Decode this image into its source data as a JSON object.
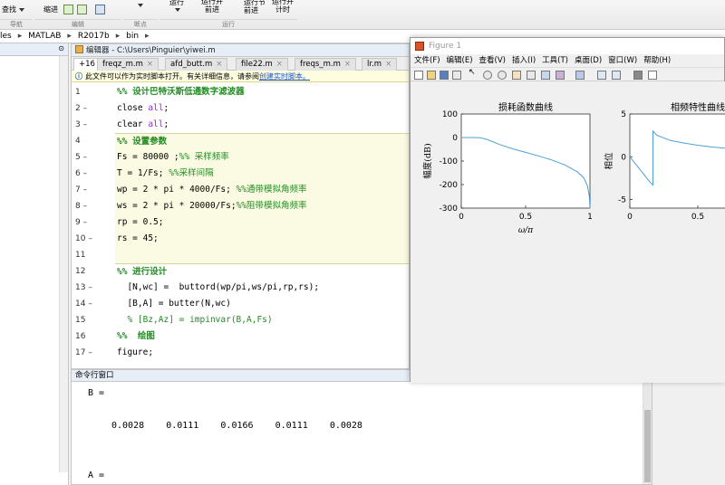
{
  "ribbon": {
    "btn_find": "查找",
    "btn_advance": "缩进",
    "sec_nav": "导航",
    "sec_edit": "编辑",
    "sec_break": "断点",
    "sec_run": "运行",
    "btn_run": "运行",
    "btn_runadv": "运行并\n前进",
    "btn_runsec": "运行节",
    "btn_advance2": "前进",
    "btn_runtime": "运行并\n计时"
  },
  "address": {
    "parts": [
      "les",
      "MATLAB",
      "R2017b",
      "bin"
    ]
  },
  "editor": {
    "title": "编辑器 - C:\\Users\\Pinguier\\yiwei.m",
    "tabs": [
      "+16",
      "freqz_m.m",
      "afd_butt.m",
      "file22.m",
      "freqs_m.m",
      "lr.m"
    ],
    "info": "此文件可以作为实时脚本打开。有关详细信息，请参阅",
    "info_link": "创建实时脚本。",
    "lines": [
      {
        "n": "1",
        "code": "%% 设计巴特沃斯低通数字滤波器"
      },
      {
        "n": "2 –",
        "code": "close all;"
      },
      {
        "n": "3 –",
        "code": "clear all;"
      },
      {
        "n": "4",
        "code": "%% 设置参数"
      },
      {
        "n": "5 –",
        "code": "Fs = 80000 ;%% 采样频率"
      },
      {
        "n": "6 –",
        "code": "T = 1/Fs; %%采样间隔"
      },
      {
        "n": "7 –",
        "code": "wp = 2 * pi * 4000/Fs; %%通带模拟角频率"
      },
      {
        "n": "8 –",
        "code": "ws = 2 * pi * 20000/Fs;%%阻带模拟角频率"
      },
      {
        "n": "9 –",
        "code": "rp = 0.5;"
      },
      {
        "n": "10 –",
        "code": "rs = 45;"
      },
      {
        "n": "11",
        "code": ""
      },
      {
        "n": "12",
        "code": "%% 进行设计"
      },
      {
        "n": "13 –",
        "code": "[N,wc] =  buttord(wp/pi,ws/pi,rp,rs);"
      },
      {
        "n": "14 –",
        "code": "[B,A] = butter(N,wc)"
      },
      {
        "n": "15",
        "code": "% [Bz,Az] = impinvar(B,A,Fs)"
      },
      {
        "n": "16",
        "code": "%%  绘图"
      },
      {
        "n": "17 –",
        "code": "figure;"
      }
    ]
  },
  "command": {
    "title": "命令行窗口",
    "line_b": "B =",
    "values": "0.0028    0.0111    0.0166    0.0111    0.0028",
    "line_a": "A ="
  },
  "figure": {
    "title": "Figure 1",
    "menu": [
      "文件(F)",
      "编辑(E)",
      "查看(V)",
      "插入(I)",
      "工具(T)",
      "桌面(D)",
      "窗口(W)",
      "帮助(H)"
    ]
  },
  "chart_data": [
    {
      "type": "line",
      "title": "损耗函数曲线",
      "xlabel": "ω/π",
      "ylabel": "幅度(dB)",
      "xlim": [
        0,
        1
      ],
      "ylim": [
        -300,
        100
      ],
      "xticks": [
        "0",
        "0.5",
        "1"
      ],
      "yticks": [
        "100",
        "0",
        "-100",
        "-200",
        "-300"
      ],
      "x": [
        0,
        0.05,
        0.1,
        0.15,
        0.2,
        0.3,
        0.4,
        0.5,
        0.6,
        0.7,
        0.8,
        0.9,
        0.95,
        0.98,
        0.995,
        1
      ],
      "y": [
        0,
        0,
        0,
        -1,
        -8,
        -30,
        -48,
        -63,
        -78,
        -95,
        -115,
        -145,
        -170,
        -205,
        -250,
        -300
      ],
      "color": "#4f9fd6"
    },
    {
      "type": "line",
      "title": "相频特性曲线",
      "xlabel": "ω/π",
      "ylabel": "相位",
      "xlim": [
        0,
        1
      ],
      "ylim": [
        -6,
        5
      ],
      "xticks": [
        "0",
        "0.5"
      ],
      "yticks": [
        "5",
        "0",
        "-5"
      ],
      "x": [
        0,
        0.05,
        0.1,
        0.15,
        0.17,
        0.17,
        0.2,
        0.3,
        0.4,
        0.5,
        0.6,
        0.7
      ],
      "y": [
        0,
        -1,
        -2,
        -3,
        -3.3,
        3,
        2.5,
        1.9,
        1.6,
        1.35,
        1.15,
        1.0
      ],
      "color": "#4f9fd6"
    }
  ]
}
